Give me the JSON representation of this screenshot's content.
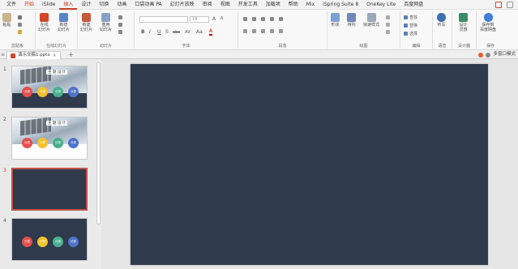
{
  "menu": [
    "文件",
    "开始",
    "iSlide",
    "插入",
    "设计",
    "切换",
    "动画",
    "口袋动画 PA",
    "幻灯片放映",
    "审阅",
    "视图",
    "开发工具",
    "加载项",
    "帮助",
    "Mix",
    "iSpring Suite 8",
    "OneKey Lite",
    "百度网盘"
  ],
  "ribbon": {
    "clipboard": {
      "paste": "粘贴",
      "label": "剪贴板"
    },
    "online_slides": {
      "online": "在线\n幻灯片",
      "new": "新增\n幻灯片",
      "label": "在线幻灯片"
    },
    "slides": {
      "new": "新建\n幻灯片",
      "reuse": "重用\n幻灯片",
      "label": "幻灯片"
    },
    "font": {
      "size": "18",
      "label": "字体",
      "letters": [
        "B",
        "I",
        "U",
        "S",
        "abc",
        "AV",
        "Aa",
        "A"
      ]
    },
    "paragraph": {
      "label": "段落"
    },
    "drawing": {
      "shape": "形状",
      "arrange": "排列",
      "quick_styles": "快速样式",
      "label": "绘图"
    },
    "editing": {
      "find": "查找",
      "replace": "替换",
      "select": "选择",
      "label": "编辑"
    },
    "voice": {
      "dictate": "听写",
      "label": "语音"
    },
    "designer": {
      "design_ideas": "设计\n灵感",
      "label": "设计器"
    },
    "save": {
      "baidu": "保存到\n百度网盘",
      "label": "保存"
    }
  },
  "tabstrip": {
    "doc_name": "演示文稿1.pptx",
    "close": "×",
    "add": "+",
    "mode": "多窗口模式"
  },
  "slides": [
    {
      "num": "1",
      "title": "主 题 设 计",
      "circles": [
        "分类",
        "分类",
        "分类",
        "分类"
      ]
    },
    {
      "num": "2",
      "title": "主 题 设 计",
      "circles": [
        "分类",
        "分类",
        "分类",
        "分类"
      ]
    },
    {
      "num": "3"
    },
    {
      "num": "4",
      "circles": [
        "分类",
        "分类",
        "分类",
        "分类"
      ]
    }
  ],
  "colors": {
    "accent": "#c43e1c",
    "slide_bg": "#2f3b4c",
    "dot1": "#e3504c",
    "dot2": "#f2c12e",
    "dot3": "#49b08f",
    "dot4": "#4e73c9"
  }
}
